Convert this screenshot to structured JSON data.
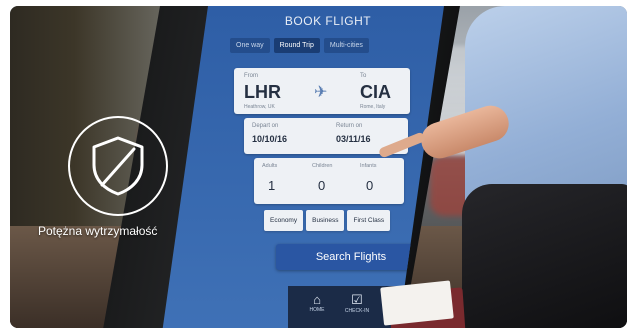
{
  "feature": {
    "caption": "Potężna wytrzymałość",
    "icon": "shield-slash-icon"
  },
  "kiosk": {
    "title": "BOOK FLIGHT",
    "tabs": [
      "One way",
      "Round Trip",
      "Multi-cities"
    ],
    "active_tab": "Round Trip",
    "from": {
      "label": "From",
      "code": "LHR",
      "city": "Heathrow, UK"
    },
    "to": {
      "label": "To",
      "code": "CIA",
      "city": "Rome, Italy"
    },
    "depart": {
      "label": "Depart on",
      "date": "10/10/16"
    },
    "return": {
      "label": "Return on",
      "date": "03/11/16"
    },
    "passengers": [
      {
        "label": "Adults",
        "value": "1"
      },
      {
        "label": "Children",
        "value": "0"
      },
      {
        "label": "Infants",
        "value": "0"
      }
    ],
    "classes": [
      "Economy",
      "Business",
      "First Class"
    ],
    "search_label": "Search Flights",
    "nav": [
      {
        "icon": "home-icon",
        "label": "HOME"
      },
      {
        "icon": "check-in-icon",
        "label": "CHECK-IN"
      }
    ]
  }
}
